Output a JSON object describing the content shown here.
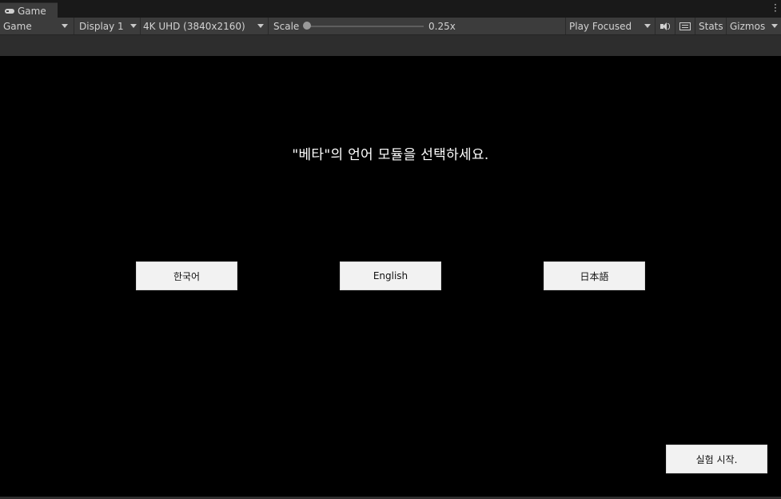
{
  "window": {
    "tab_label": "Game",
    "tab_icon": "gamepad-icon",
    "menu_icon": "kebab-menu-icon"
  },
  "toolbar": {
    "view_mode": "Game",
    "display": "Display 1",
    "resolution": "4K UHD (3840x2160)",
    "scale_label": "Scale",
    "scale_value": "0.25x",
    "play_mode": "Play Focused",
    "audio_icon": "speaker-icon",
    "keyboard_icon": "keyboard-icon",
    "stats_label": "Stats",
    "gizmos_label": "Gizmos",
    "scale_slider_level": 0
  },
  "game": {
    "prompt": "\"베타\"의 언어 모듈을 선택하세요.",
    "language_buttons": [
      "한국어",
      "English",
      "日本語"
    ],
    "start_button": "실험 시작."
  },
  "colors": {
    "editor_bg": "#3c3c3c",
    "viewport_bg": "#000000",
    "button_bg": "#f2f2f2",
    "prompt_text": "#ffffff"
  }
}
